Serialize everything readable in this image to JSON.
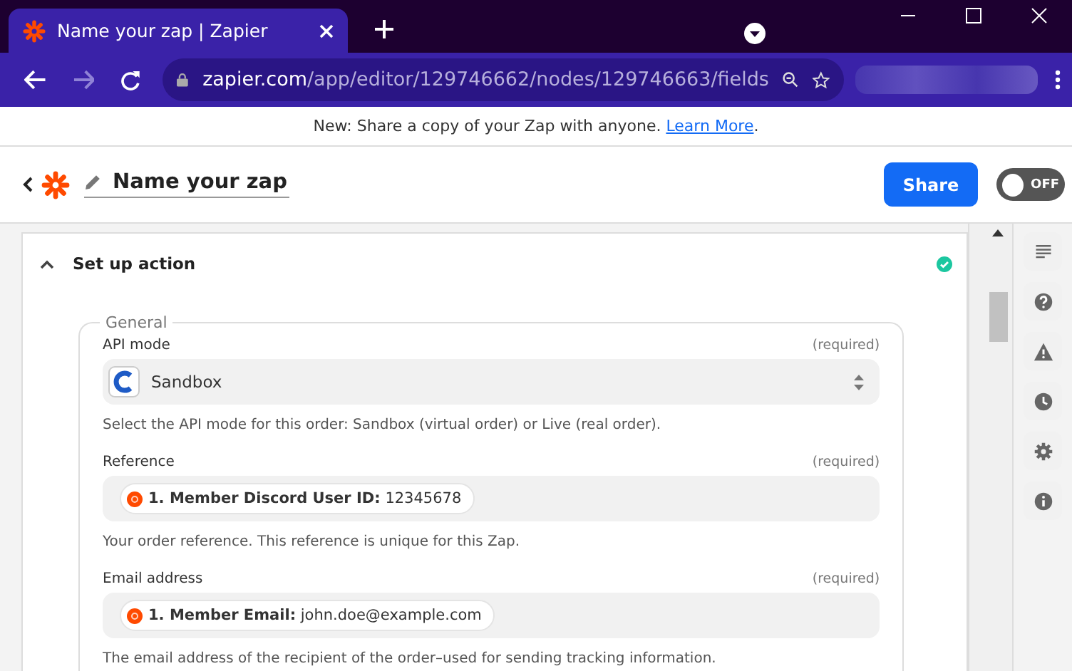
{
  "browser": {
    "tab_title": "Name your zap | Zapier",
    "url_host": "zapier.com",
    "url_path": "/app/editor/129746662/nodes/129746663/fields"
  },
  "banner": {
    "text": "New: Share a copy of your Zap with anyone.",
    "link": "Learn More",
    "after": "."
  },
  "header": {
    "title": "Name your zap",
    "share": "Share",
    "toggle": {
      "on": false,
      "label": "OFF"
    }
  },
  "section": {
    "title": "Set up action",
    "expanded": true,
    "complete": true,
    "group": "General",
    "fields": [
      {
        "kind": "select",
        "label": "API mode",
        "required": "(required)",
        "value": "Sandbox",
        "help": "Select the API mode for this order: Sandbox (virtual order) or Live (real order)."
      },
      {
        "kind": "chip",
        "label": "Reference",
        "required": "(required)",
        "chip_label": "1. Member Discord User ID:",
        "chip_value": "12345678",
        "help": "Your order reference. This reference is unique for this Zap."
      },
      {
        "kind": "chip",
        "label": "Email address",
        "required": "(required)",
        "chip_label": "1. Member Email:",
        "chip_value": "john.doe@example.com",
        "help": "The email address of the recipient of the order–used for sending tracking information."
      }
    ]
  },
  "sidebar": {
    "items": [
      {
        "kind": "details"
      },
      {
        "kind": "help"
      },
      {
        "kind": "alert"
      },
      {
        "kind": "history"
      },
      {
        "kind": "settings"
      },
      {
        "kind": "info"
      }
    ]
  }
}
